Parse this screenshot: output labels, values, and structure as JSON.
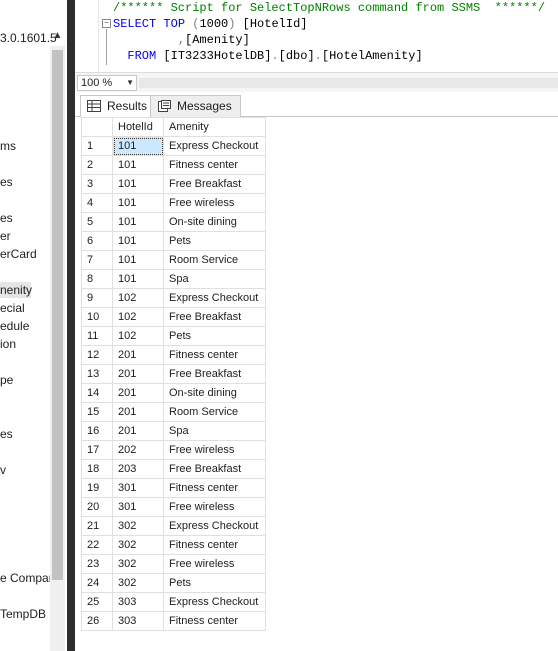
{
  "explorer": {
    "version_fragment": "3.0.1601.5",
    "nodes": [
      "ms",
      "es",
      "es",
      "er",
      "erCard",
      "nenity",
      "ecial",
      "edule",
      "ion",
      "pe",
      "es",
      "v",
      "e Compar",
      "TempDB"
    ],
    "selected_index": 5,
    "up_icon": "chevron-up-icon"
  },
  "editor": {
    "line1_comment": "/****** Script for SelectTopNRows command from SSMS  ******/",
    "line2_select": "SELECT",
    "line2_top": "TOP",
    "line2_open": " (",
    "line2_num": "1000",
    "line2_close": ") ",
    "line2_col": "[HotelId]",
    "line3_comma": ",",
    "line3_col": "[Amenity]",
    "line4_from": "FROM",
    "line4_db": "[IT3233HotelDB]",
    "line4_dot1": ".",
    "line4_schema": "[dbo]",
    "line4_dot2": ".",
    "line4_table": "[HotelAmenity]"
  },
  "zoom": {
    "value": "100 %"
  },
  "tabs": [
    {
      "label": "Results",
      "icon": "grid-icon",
      "active": true
    },
    {
      "label": "Messages",
      "icon": "messages-icon",
      "active": false
    }
  ],
  "grid": {
    "columns": [
      "HotelId",
      "Amenity"
    ],
    "rows": [
      [
        "1",
        "101",
        "Express Checkout"
      ],
      [
        "2",
        "101",
        "Fitness center"
      ],
      [
        "3",
        "101",
        "Free Breakfast"
      ],
      [
        "4",
        "101",
        "Free wireless"
      ],
      [
        "5",
        "101",
        "On-site dining"
      ],
      [
        "6",
        "101",
        "Pets"
      ],
      [
        "7",
        "101",
        "Room Service"
      ],
      [
        "8",
        "101",
        "Spa"
      ],
      [
        "9",
        "102",
        "Express Checkout"
      ],
      [
        "10",
        "102",
        "Free Breakfast"
      ],
      [
        "11",
        "102",
        "Pets"
      ],
      [
        "12",
        "201",
        "Fitness center"
      ],
      [
        "13",
        "201",
        "Free Breakfast"
      ],
      [
        "14",
        "201",
        "On-site dining"
      ],
      [
        "15",
        "201",
        "Room Service"
      ],
      [
        "16",
        "201",
        "Spa"
      ],
      [
        "17",
        "202",
        "Free wireless"
      ],
      [
        "18",
        "203",
        "Free Breakfast"
      ],
      [
        "19",
        "301",
        "Fitness center"
      ],
      [
        "20",
        "301",
        "Free wireless"
      ],
      [
        "21",
        "302",
        "Express Checkout"
      ],
      [
        "22",
        "302",
        "Fitness center"
      ],
      [
        "23",
        "302",
        "Free wireless"
      ],
      [
        "24",
        "302",
        "Pets"
      ],
      [
        "25",
        "303",
        "Express Checkout"
      ],
      [
        "26",
        "303",
        "Fitness center"
      ]
    ],
    "selected_cell": [
      0,
      1
    ]
  }
}
